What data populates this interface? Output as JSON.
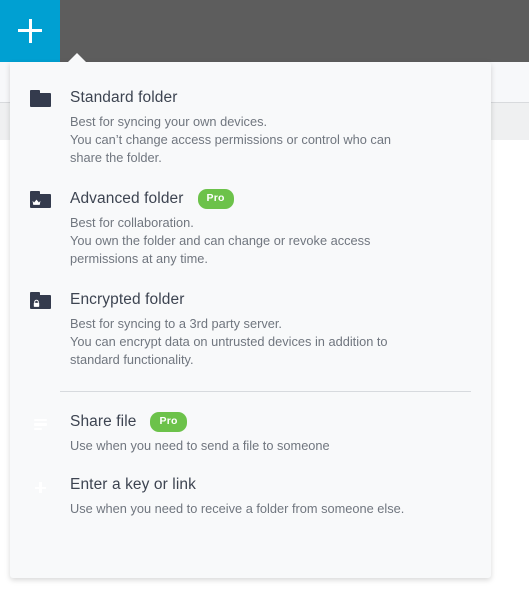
{
  "colors": {
    "accent_blue": "#00a0d2",
    "topbar_gray": "#5d5d5d",
    "icon_dark": "#343b4d",
    "badge_green": "#6cc24a",
    "panel_bg": "#f8f9fa",
    "title_text": "#3d4451",
    "desc_text": "#70767f"
  },
  "topbar": {
    "add_button": {
      "icon": "plus-icon",
      "label": "+"
    }
  },
  "dropdown": {
    "items": [
      {
        "id": "standard-folder",
        "icon": "folder-icon",
        "title": "Standard folder",
        "badge": null,
        "desc_lines": [
          "Best for syncing your own devices.",
          "You can’t change access permissions or control who can",
          "share the folder."
        ]
      },
      {
        "id": "advanced-folder",
        "icon": "folder-crown-icon",
        "title": "Advanced folder",
        "badge": "Pro",
        "desc_lines": [
          "Best for collaboration.",
          "You own the folder and can change or revoke access",
          "permissions at any time."
        ]
      },
      {
        "id": "encrypted-folder",
        "icon": "folder-lock-icon",
        "title": "Encrypted folder",
        "badge": null,
        "desc_lines": [
          "Best for syncing to a 3rd party server.",
          "You can encrypt data on untrusted devices in addition to",
          "standard functionality."
        ]
      },
      {
        "id": "share-file",
        "icon": "file-lines-icon",
        "title": "Share file",
        "badge": "Pro",
        "desc_lines": [
          "Use when you need to send a file to someone"
        ]
      },
      {
        "id": "enter-key-or-link",
        "icon": "circle-plus-icon",
        "title": "Enter a key or link",
        "badge": null,
        "desc_lines": [
          "Use when you need to receive a folder from someone else."
        ]
      }
    ]
  }
}
